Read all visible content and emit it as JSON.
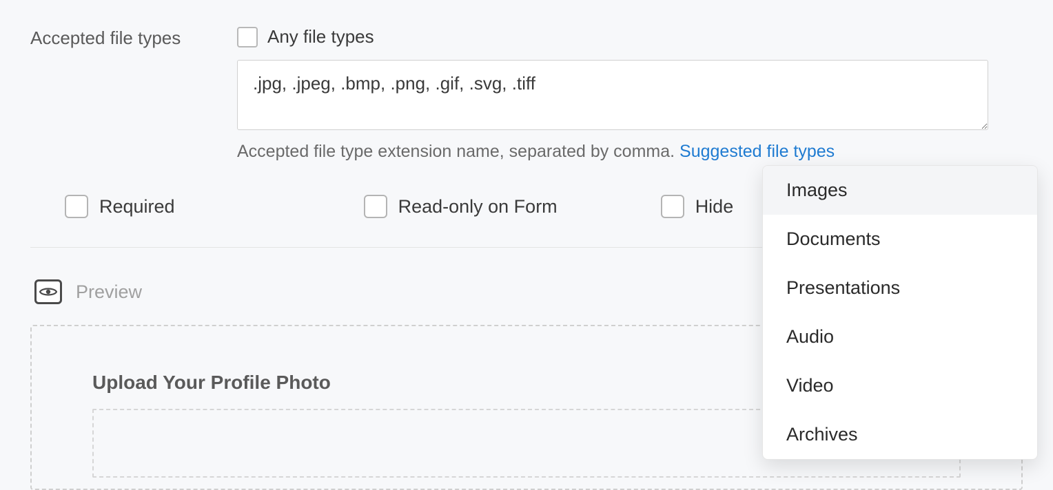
{
  "fields": {
    "accepted_file_types_label": "Accepted file types",
    "any_file_types_label": "Any file types",
    "file_types_value": ".jpg, .jpeg, .bmp, .png, .gif, .svg, .tiff",
    "help_text_prefix": "Accepted file type extension name, separated by comma. ",
    "suggested_link": "Suggested file types"
  },
  "options": {
    "required": "Required",
    "readonly": "Read-only on Form",
    "hide": "Hide"
  },
  "preview": {
    "label": "Preview",
    "upload_title": "Upload Your Profile Photo"
  },
  "dropdown": {
    "items": [
      "Images",
      "Documents",
      "Presentations",
      "Audio",
      "Video",
      "Archives"
    ]
  }
}
